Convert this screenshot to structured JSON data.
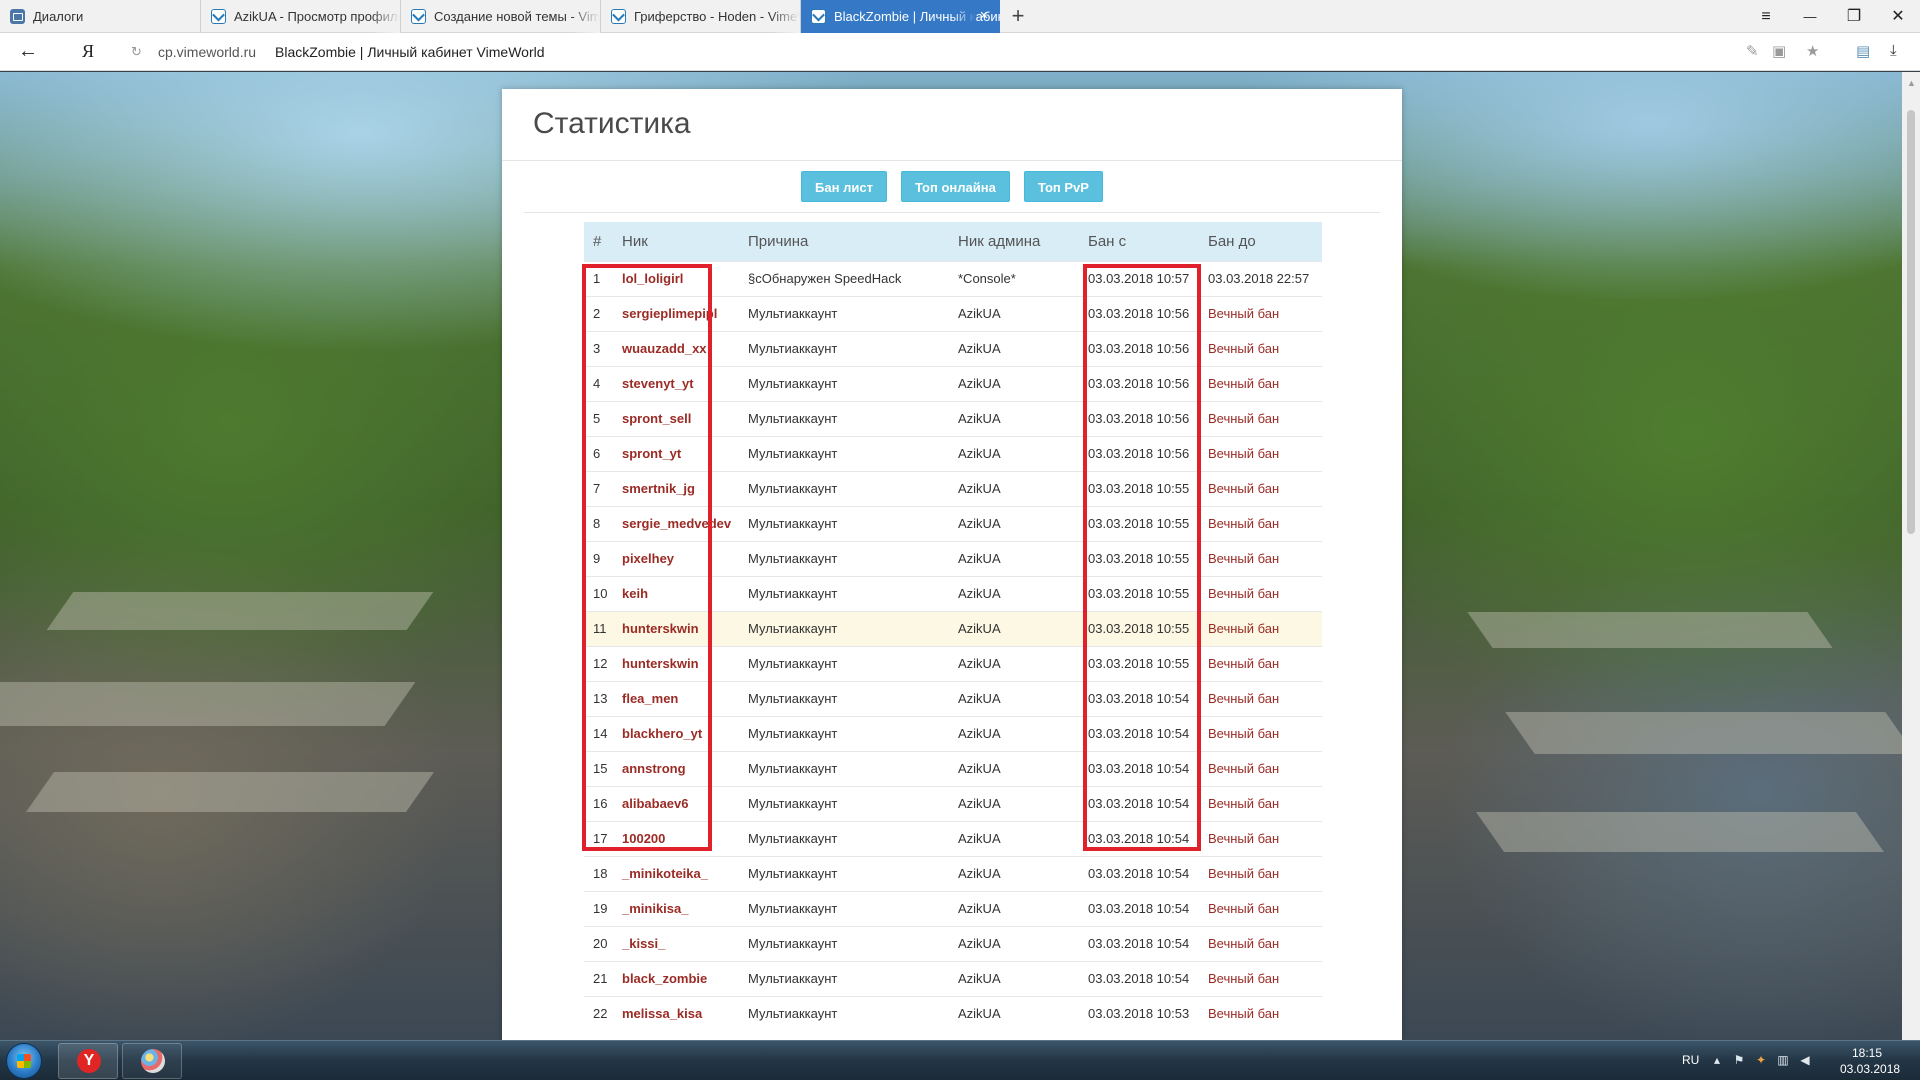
{
  "browser": {
    "tabs": [
      {
        "label": "Диалоги",
        "icon": "vk-icon"
      },
      {
        "label": "AzikUA - Просмотр профиля",
        "icon": "vimeworld-icon"
      },
      {
        "label": "Создание новой темы - VimeWorld",
        "icon": "vimeworld-icon"
      },
      {
        "label": "Гриферство - Hoden - VimeWorld",
        "icon": "vimeworld-icon"
      },
      {
        "label": "BlackZombie | Личный кабинет",
        "icon": "vimeworld-icon"
      }
    ],
    "new_tab": "+",
    "close_tab": "×",
    "window": {
      "menu": "≡",
      "minimize": "—",
      "restore": "❐",
      "close": "✕"
    },
    "address": {
      "back": "←",
      "yandex": "Я",
      "reload": "↻",
      "domain": "cp.vimeworld.ru",
      "title": "BlackZombie | Личный кабинет VimeWorld"
    }
  },
  "page": {
    "title": "Статистика",
    "buttons": {
      "banlist": "Бан лист",
      "top_online": "Топ онлайна",
      "top_pvp": "Топ PvP"
    },
    "table": {
      "headers": {
        "num": "#",
        "nick": "Ник",
        "reason": "Причина",
        "admin": "Ник админа",
        "from": "Бан с",
        "until": "Бан до"
      },
      "rows": [
        {
          "num": "1",
          "nick": "lol_loligirl",
          "reason": "§cОбнаружен SpeedHack",
          "admin": "*Console*",
          "from": "03.03.2018 10:57",
          "until": "03.03.2018 22:57"
        },
        {
          "num": "2",
          "nick": "sergieplimepipl",
          "reason": "Мультиаккаунт",
          "admin": "AzikUA",
          "from": "03.03.2018 10:56",
          "until": "Вечный бан"
        },
        {
          "num": "3",
          "nick": "wuauzadd_xx",
          "reason": "Мультиаккаунт",
          "admin": "AzikUA",
          "from": "03.03.2018 10:56",
          "until": "Вечный бан"
        },
        {
          "num": "4",
          "nick": "stevenyt_yt",
          "reason": "Мультиаккаунт",
          "admin": "AzikUA",
          "from": "03.03.2018 10:56",
          "until": "Вечный бан"
        },
        {
          "num": "5",
          "nick": "spront_sell",
          "reason": "Мультиаккаунт",
          "admin": "AzikUA",
          "from": "03.03.2018 10:56",
          "until": "Вечный бан"
        },
        {
          "num": "6",
          "nick": "spront_yt",
          "reason": "Мультиаккаунт",
          "admin": "AzikUA",
          "from": "03.03.2018 10:56",
          "until": "Вечный бан"
        },
        {
          "num": "7",
          "nick": "smertnik_jg",
          "reason": "Мультиаккаунт",
          "admin": "AzikUA",
          "from": "03.03.2018 10:55",
          "until": "Вечный бан"
        },
        {
          "num": "8",
          "nick": "sergie_medvedev",
          "reason": "Мультиаккаунт",
          "admin": "AzikUA",
          "from": "03.03.2018 10:55",
          "until": "Вечный бан"
        },
        {
          "num": "9",
          "nick": "pixelhey",
          "reason": "Мультиаккаунт",
          "admin": "AzikUA",
          "from": "03.03.2018 10:55",
          "until": "Вечный бан"
        },
        {
          "num": "10",
          "nick": "keih",
          "reason": "Мультиаккаунт",
          "admin": "AzikUA",
          "from": "03.03.2018 10:55",
          "until": "Вечный бан"
        },
        {
          "num": "11",
          "nick": "hunterskwin",
          "reason": "Мультиаккаунт",
          "admin": "AzikUA",
          "from": "03.03.2018 10:55",
          "until": "Вечный бан"
        },
        {
          "num": "12",
          "nick": "hunterskwin",
          "reason": "Мультиаккаунт",
          "admin": "AzikUA",
          "from": "03.03.2018 10:55",
          "until": "Вечный бан"
        },
        {
          "num": "13",
          "nick": "flea_men",
          "reason": "Мультиаккаунт",
          "admin": "AzikUA",
          "from": "03.03.2018 10:54",
          "until": "Вечный бан"
        },
        {
          "num": "14",
          "nick": "blackhero_yt",
          "reason": "Мультиаккаунт",
          "admin": "AzikUA",
          "from": "03.03.2018 10:54",
          "until": "Вечный бан"
        },
        {
          "num": "15",
          "nick": "annstrong",
          "reason": "Мультиаккаунт",
          "admin": "AzikUA",
          "from": "03.03.2018 10:54",
          "until": "Вечный бан"
        },
        {
          "num": "16",
          "nick": "alibabaev6",
          "reason": "Мультиаккаунт",
          "admin": "AzikUA",
          "from": "03.03.2018 10:54",
          "until": "Вечный бан"
        },
        {
          "num": "17",
          "nick": "100200",
          "reason": "Мультиаккаунт",
          "admin": "AzikUA",
          "from": "03.03.2018 10:54",
          "until": "Вечный бан"
        },
        {
          "num": "18",
          "nick": "_minikoteika_",
          "reason": "Мультиаккаунт",
          "admin": "AzikUA",
          "from": "03.03.2018 10:54",
          "until": "Вечный бан"
        },
        {
          "num": "19",
          "nick": "_minikisa_",
          "reason": "Мультиаккаунт",
          "admin": "AzikUA",
          "from": "03.03.2018 10:54",
          "until": "Вечный бан"
        },
        {
          "num": "20",
          "nick": "_kissi_",
          "reason": "Мультиаккаунт",
          "admin": "AzikUA",
          "from": "03.03.2018 10:54",
          "until": "Вечный бан"
        },
        {
          "num": "21",
          "nick": "black_zombie",
          "reason": "Мультиаккаунт",
          "admin": "AzikUA",
          "from": "03.03.2018 10:54",
          "until": "Вечный бан"
        },
        {
          "num": "22",
          "nick": "melissa_kisa",
          "reason": "Мультиаккаунт",
          "admin": "AzikUA",
          "from": "03.03.2018 10:53",
          "until": "Вечный бан"
        }
      ]
    }
  },
  "taskbar": {
    "yandex_letter": "Y",
    "lang": "RU",
    "time": "18:15",
    "date": "03.03.2018"
  },
  "colors": {
    "accent": "#5bc0de",
    "active_tab": "#3478c6",
    "nick": "#9b2b25",
    "highlight_row": "#fcf8e3",
    "annotation": "#e0202a"
  }
}
